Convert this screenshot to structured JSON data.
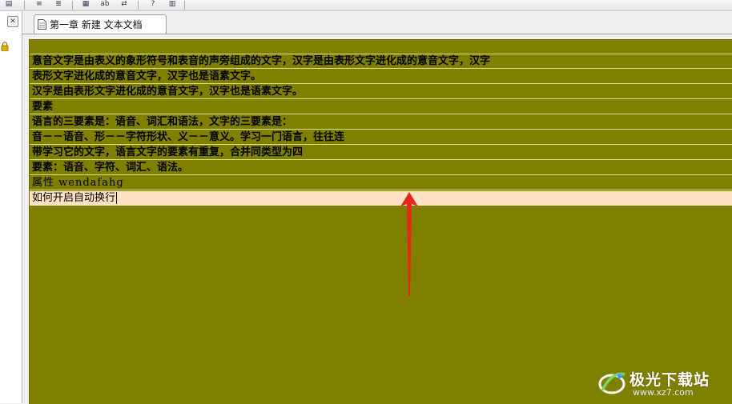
{
  "toolbar": {
    "buttons": [
      {
        "icon": "document-icon",
        "glyph": "▤"
      },
      {
        "icon": "indent-icon",
        "glyph": "≡"
      },
      {
        "icon": "outdent-icon",
        "glyph": "≣"
      },
      {
        "icon": "grid-icon",
        "glyph": "▦"
      },
      {
        "icon": "spellcheck-icon",
        "glyph": "ab"
      },
      {
        "icon": "replace-icon",
        "glyph": "⇄"
      },
      {
        "icon": "help-icon",
        "glyph": "?"
      },
      {
        "icon": "notes-icon",
        "glyph": "▥"
      }
    ]
  },
  "left_panel": {
    "close_glyph": "✕"
  },
  "tab": {
    "label": "第一章 新建 文本文档"
  },
  "editor": {
    "background": "#808000",
    "current_line_color": "#ffe1c6",
    "lines": [
      "",
      "意音文字是由表义的象形符号和表音的声旁组成的文字，汉字是由表形文字进化成的意音文字，汉字",
      "表形文字进化成的意音文字，汉字也是语素文字。",
      "汉字是由表形文字进化成的意音文字，汉字也是语素文字。",
      "要素",
      "语言的三要素是：语音、词汇和语法，文字的三要素是：",
      "音－－语音、形－－字符形状、义－－意义。学习一门语言，往往连",
      "带学习它的文字，语言文字的要素有重复，合并同类型为四",
      "要素：语音、字符、词汇、语法。",
      "属性 wendafahg",
      "如何开启自动换行"
    ]
  },
  "annotation": {
    "arrow_color": "#e8271b"
  },
  "watermark": {
    "title": "极光下载站",
    "url": "www.xz7.com"
  }
}
